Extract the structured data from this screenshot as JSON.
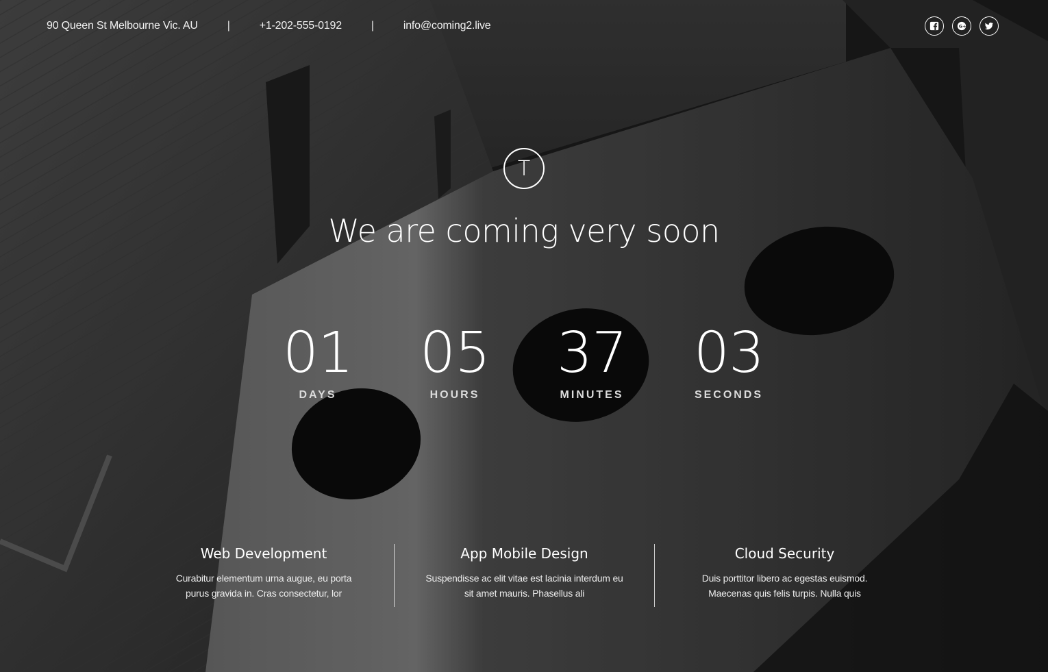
{
  "header": {
    "address": "90 Queen St Melbourne Vic. AU",
    "separator": "|",
    "phone": "+1-202-555-0192",
    "email": "info@coming2.live",
    "social": [
      {
        "icon": "facebook-icon"
      },
      {
        "icon": "google-plus-icon"
      },
      {
        "icon": "twitter-icon"
      }
    ]
  },
  "logo": {
    "letter": "T"
  },
  "headline": "We are coming very soon",
  "countdown": [
    {
      "value": "01",
      "label": "DAYS"
    },
    {
      "value": "05",
      "label": "HOURS"
    },
    {
      "value": "37",
      "label": "MINUTES"
    },
    {
      "value": "03",
      "label": "SECONDS"
    }
  ],
  "features": [
    {
      "title": "Web Development",
      "text": "Curabitur elementum urna augue, eu porta purus gravida in. Cras consectetur, lor"
    },
    {
      "title": "App Mobile Design",
      "text": "Suspendisse ac elit vitae est lacinia interdum eu sit amet mauris. Phasellus ali"
    },
    {
      "title": "Cloud Security",
      "text": "Duis porttitor libero ac egestas euismod. Maecenas quis felis turpis. Nulla quis"
    }
  ],
  "colors": {
    "text": "#ffffff",
    "label": "#dcdcdc",
    "background": "#1a1a1a"
  }
}
